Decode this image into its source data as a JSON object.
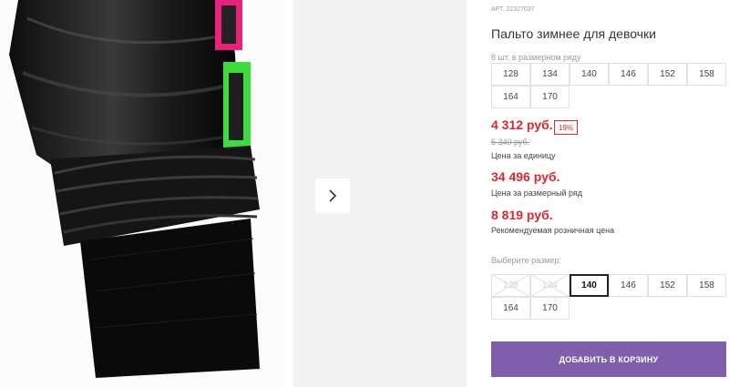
{
  "product": {
    "article_label": "АРТ. 22327037",
    "title": "Пальто зимнее для девочки",
    "row_info": "8 шт. в размерном ряду"
  },
  "size_row": [
    "128",
    "134",
    "140",
    "146",
    "152",
    "158",
    "164",
    "170"
  ],
  "prices": {
    "unit_price": "4 312 руб.",
    "discount": "19%",
    "old_price": "5 340 руб.",
    "unit_caption": "Цена за единицу",
    "row_price": "34 496 руб.",
    "row_caption": "Цена за размерный ряд",
    "retail_price": "8 819 руб.",
    "retail_caption": "Рекомендуемая розничная цена"
  },
  "size_picker": {
    "label": "Выберите размер:",
    "options": [
      {
        "label": "128",
        "state": "disabled"
      },
      {
        "label": "134",
        "state": "disabled"
      },
      {
        "label": "140",
        "state": "selected"
      },
      {
        "label": "146",
        "state": "available"
      },
      {
        "label": "152",
        "state": "available"
      },
      {
        "label": "158",
        "state": "available"
      },
      {
        "label": "164",
        "state": "available"
      },
      {
        "label": "170",
        "state": "available"
      }
    ]
  },
  "cart": {
    "button_label": "ДОБАВИТЬ В КОРЗИНУ"
  },
  "icons": {
    "next": "chevron-right-icon"
  },
  "colors": {
    "accent": "#7f5eab",
    "price": "#e0262d",
    "muted": "#9a9a9a"
  }
}
